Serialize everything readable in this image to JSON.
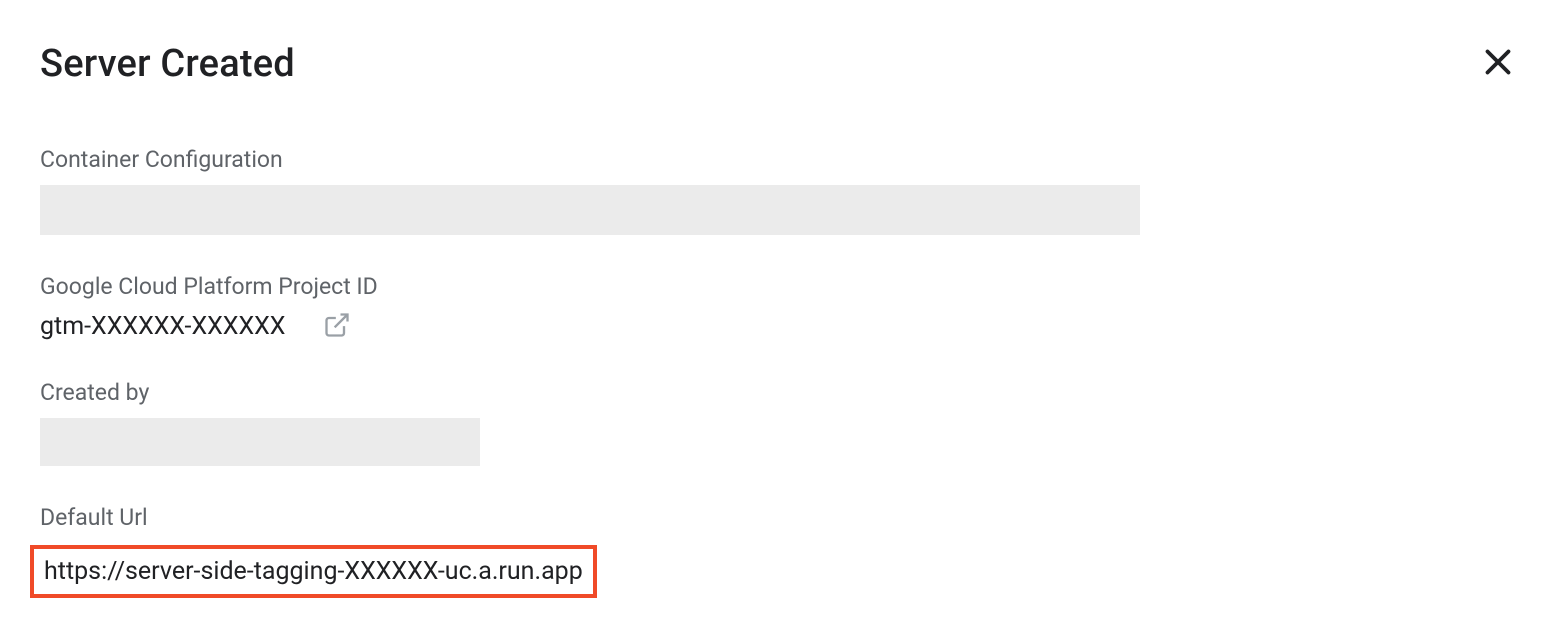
{
  "dialog": {
    "title": "Server Created"
  },
  "fields": {
    "container_config": {
      "label": "Container Configuration"
    },
    "project_id": {
      "label": "Google Cloud Platform Project ID",
      "value": "gtm-XXXXXX-XXXXXX"
    },
    "created_by": {
      "label": "Created by"
    },
    "default_url": {
      "label": "Default Url",
      "value": "https://server-side-tagging-XXXXXX-uc.a.run.app"
    }
  }
}
